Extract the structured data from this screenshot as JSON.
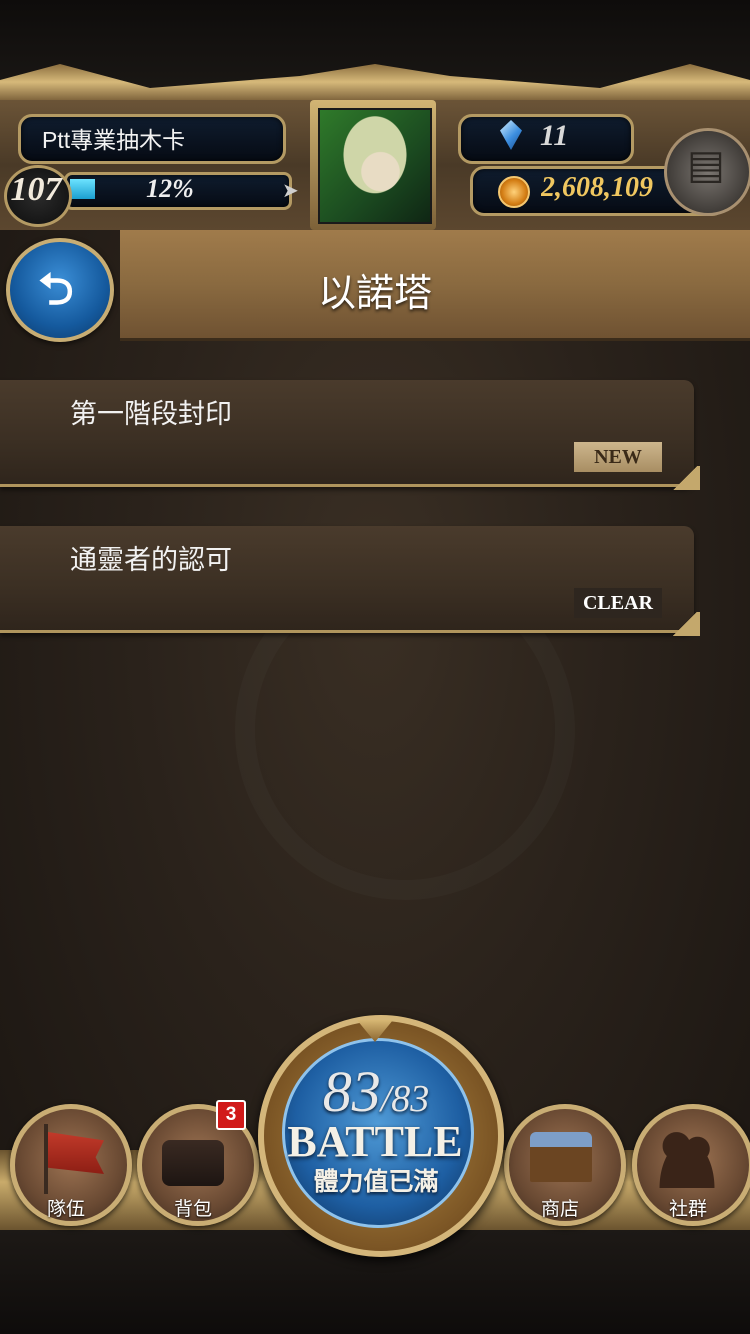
{
  "player": {
    "name": "Ptt專業抽木卡",
    "level": "107",
    "xp_percent_text": "12%",
    "xp_fraction": 0.12,
    "gems": "11",
    "coins": "2,608,109"
  },
  "header": {
    "title": "以諾塔"
  },
  "stages": [
    {
      "title": "第一階段封印",
      "badge": "NEW"
    },
    {
      "title": "通靈者的認可",
      "badge": "CLEAR"
    }
  ],
  "bottom_nav": {
    "team_label": "隊伍",
    "bag_label": "背包",
    "bag_badge": "3",
    "battle": {
      "stamina_current": "83",
      "stamina_max": "/83",
      "label": "BATTLE",
      "status": "體力值已滿"
    },
    "shop_label": "商店",
    "social_label": "社群"
  },
  "colors": {
    "accent_gold": "#c9ad74",
    "battle_blue": "#1e5fa3",
    "badge_red": "#d11a1a"
  }
}
